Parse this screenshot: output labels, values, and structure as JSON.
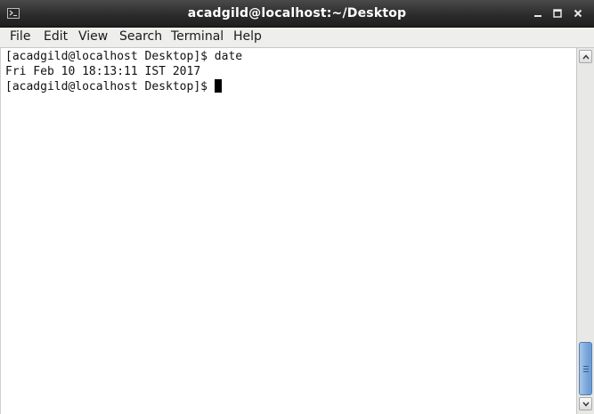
{
  "window": {
    "title": "acadgild@localhost:~/Desktop",
    "icons": {
      "app": "terminal-icon",
      "minimize": "minimize-icon",
      "maximize": "maximize-icon",
      "close": "close-icon"
    }
  },
  "menubar": {
    "items": [
      {
        "label": "File"
      },
      {
        "label": "Edit"
      },
      {
        "label": "View"
      },
      {
        "label": "Search"
      },
      {
        "label": "Terminal"
      },
      {
        "label": "Help"
      }
    ]
  },
  "terminal": {
    "lines": [
      {
        "text": "[acadgild@localhost Desktop]$ date"
      },
      {
        "text": "Fri Feb 10 18:13:11 IST 2017"
      },
      {
        "text": "[acadgild@localhost Desktop]$ "
      }
    ]
  },
  "colors": {
    "titlebar": "#2c2c2c",
    "menubar": "#eeeeec",
    "scroll_thumb": "#7aa6d8",
    "text": "#111111",
    "background": "#ffffff"
  }
}
